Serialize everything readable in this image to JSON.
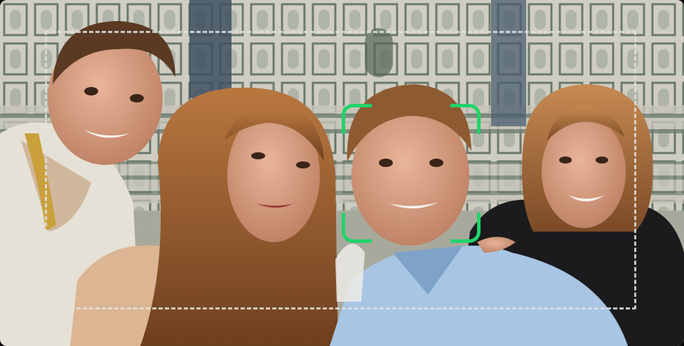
{
  "viewfinder": {
    "accent_color": "#22d36a",
    "guide_color": "#e1e1e1",
    "subjects": [
      {
        "name": "subject-left-man",
        "face_detected": false
      },
      {
        "name": "subject-long-hair-woman",
        "face_detected": false
      },
      {
        "name": "subject-center-man",
        "face_detected": true
      },
      {
        "name": "subject-right-woman",
        "face_detected": false
      }
    ]
  }
}
